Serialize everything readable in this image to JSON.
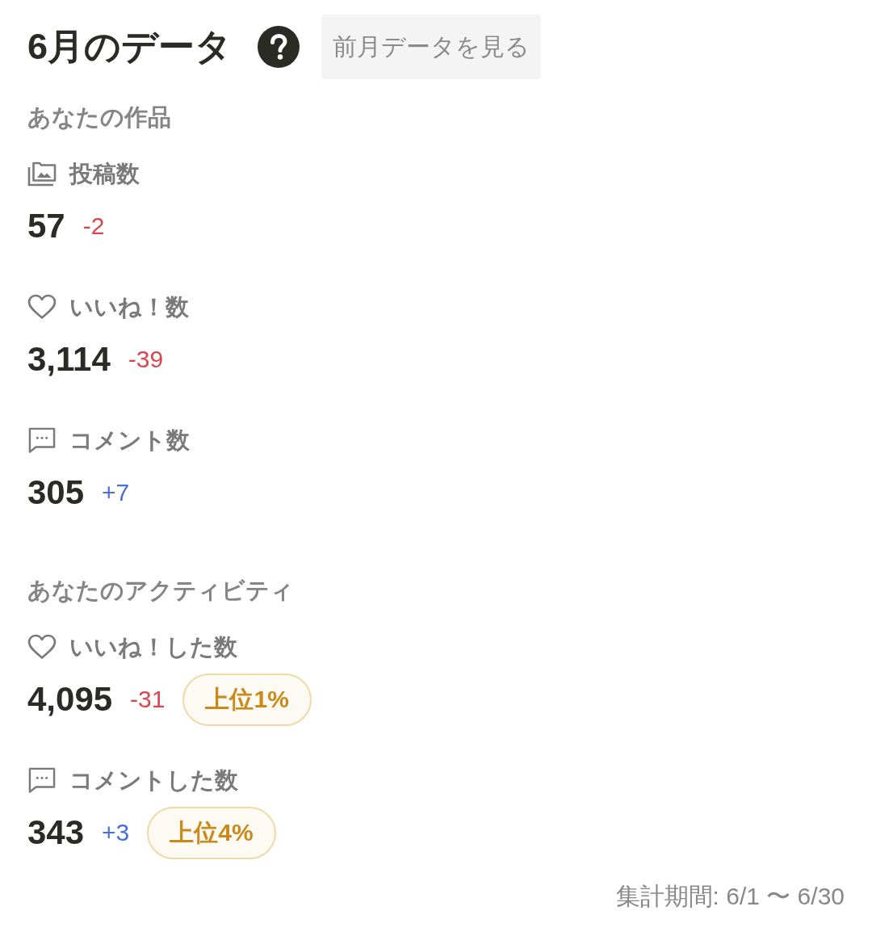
{
  "header": {
    "title": "6月のデータ",
    "previous_month_button": "前月データを見る"
  },
  "sections": [
    {
      "heading": "あなたの作品",
      "metrics": [
        {
          "kind": "gallery",
          "label": "投稿数",
          "value": "57",
          "change": "-2",
          "color": "#d8474e"
        },
        {
          "kind": "heart",
          "label": "いいね！数",
          "value": "3,114",
          "change": "-39",
          "color": "#d8474e"
        },
        {
          "kind": "comment",
          "label": "コメント数",
          "value": "305",
          "change": "+7",
          "color": "#4a6fd8"
        }
      ]
    },
    {
      "heading": "あなたのアクティビティ",
      "metrics": [
        {
          "kind": "heart",
          "label": "いいね！した数",
          "value": "4,095",
          "change": "-31",
          "color": "#d8474e",
          "rank": "上位1%"
        },
        {
          "kind": "comment",
          "label": "コメントした数",
          "value": "343",
          "change": "+3",
          "color": "#4a6fd8",
          "rank": "上位4%"
        }
      ]
    }
  ],
  "period": "集計期間: 6/1 〜 6/30"
}
